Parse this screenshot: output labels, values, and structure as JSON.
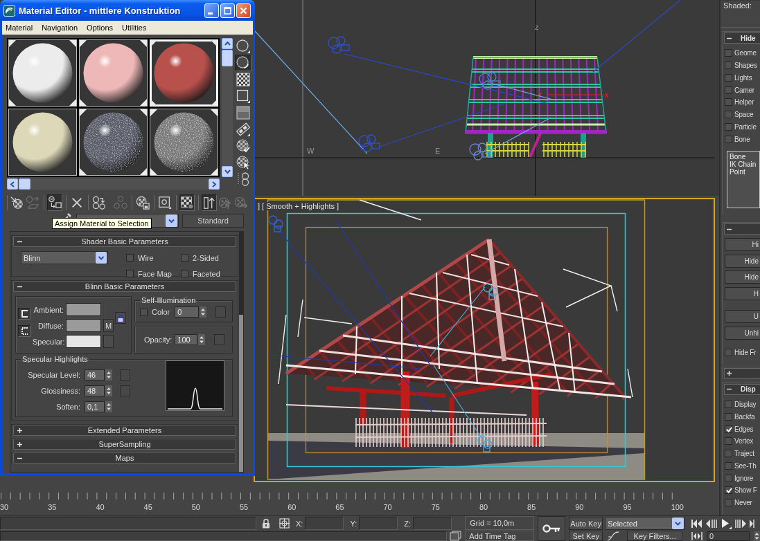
{
  "material_editor": {
    "title": "Material Editor - mittlere Konstruktion",
    "menu": [
      "Material",
      "Navigation",
      "Options",
      "Utilities"
    ],
    "sample_slots": [
      {
        "color": "#ececec",
        "textured": false,
        "in_scene": true,
        "selected": false
      },
      {
        "color": "#efb8b8",
        "textured": false,
        "in_scene": true,
        "selected": false
      },
      {
        "color": "#b8504c",
        "textured": false,
        "in_scene": true,
        "selected": true
      },
      {
        "color": "#dcd8b8",
        "textured": false,
        "in_scene": false,
        "selected": false
      },
      {
        "color": "#5a5c68",
        "textured": true,
        "in_scene": true,
        "selected": false
      },
      {
        "color": "#7a7a7a",
        "textured": true,
        "in_scene": true,
        "selected": false
      }
    ],
    "side_tools": [
      {
        "pressed": false
      },
      {
        "pressed": true
      },
      {
        "pressed": false
      },
      {
        "pressed": false
      },
      {
        "pressed": false
      },
      {
        "pressed": false
      },
      {
        "pressed": false
      },
      {
        "pressed": false
      },
      {
        "pressed": false
      }
    ],
    "toolbar": [
      {
        "pressed": false,
        "disabled": false
      },
      {
        "pressed": false,
        "disabled": true
      },
      {
        "pressed": true,
        "disabled": false
      },
      {
        "pressed": false,
        "disabled": false
      },
      {
        "pressed": false,
        "disabled": false
      },
      {
        "pressed": false,
        "disabled": true
      },
      {
        "pressed": false,
        "disabled": false
      },
      {
        "pressed": false,
        "disabled": false
      },
      {
        "pressed": true,
        "disabled": false
      },
      {
        "pressed": true,
        "disabled": false
      },
      {
        "pressed": false,
        "disabled": true
      },
      {
        "pressed": false,
        "disabled": true
      }
    ],
    "material_type": "Standard",
    "tooltip": "Assign Material to Selection",
    "rollouts": [
      {
        "kind": "shader",
        "title": "Shader Basic Parameters",
        "expanded": true,
        "shader": "Blinn",
        "options": [
          {
            "label": "Wire",
            "checked": false
          },
          {
            "label": "2-Sided",
            "checked": false
          },
          {
            "label": "Face Map",
            "checked": false
          },
          {
            "label": "Faceted",
            "checked": false
          }
        ]
      },
      {
        "kind": "basic",
        "title": "Blinn Basic Parameters",
        "expanded": true,
        "colors": [
          {
            "label": "Ambient:",
            "color": "#9a9a9a",
            "map_slot": false
          },
          {
            "label": "Diffuse:",
            "color": "#9a9a9a",
            "map_slot": true,
            "map_label": "M"
          },
          {
            "label": "Specular:",
            "color": "#e6e6e6",
            "map_slot": true
          }
        ],
        "self_illumination": {
          "title": "Self-Illumination",
          "label": "Color",
          "checked": false,
          "value": "0"
        },
        "opacity": {
          "label": "Opacity:",
          "value": "100"
        },
        "highlights": {
          "title": "Specular Highlights",
          "fields": [
            {
              "label": "Specular Level:",
              "value": "46",
              "map_slot": true
            },
            {
              "label": "Glossiness:",
              "value": "48",
              "map_slot": true
            },
            {
              "label": "Soften:",
              "value": "0,1",
              "map_slot": false
            }
          ]
        }
      },
      {
        "title": "Extended Parameters",
        "expanded": false
      },
      {
        "title": "SuperSampling",
        "expanded": false
      },
      {
        "title": "Maps",
        "expanded": true
      }
    ]
  },
  "front_viewport": {
    "compass_labels": [
      "W",
      "E"
    ],
    "axis_label": "z",
    "gizmo_labels": [
      "y",
      "x"
    ]
  },
  "camera_viewport": {
    "label": "] [ Smooth + Highlights ]",
    "active": true
  },
  "command_panel": {
    "shading_label": "Shaded:",
    "rollouts": [
      {
        "kind": "checklist",
        "title": "Hide",
        "expanded": true,
        "items": [
          {
            "label": "Geome",
            "checked": false
          },
          {
            "label": "Shapes",
            "checked": false
          },
          {
            "label": "Lights",
            "checked": false
          },
          {
            "label": "Camer",
            "checked": false
          },
          {
            "label": "Helper",
            "checked": false
          },
          {
            "label": "Space",
            "checked": false
          },
          {
            "label": "Particle",
            "checked": false
          },
          {
            "label": "Bone",
            "checked": false
          }
        ],
        "list": [
          "Bone",
          "IK Chain",
          "Point"
        ]
      },
      {
        "kind": "buttons",
        "expanded": true,
        "buttons": [
          "Hi",
          "Hide",
          "Hide",
          "H",
          "U",
          "Unhi"
        ],
        "option": {
          "label": "Hide Fr",
          "checked": false
        }
      },
      {
        "kind": "header",
        "expanded": false
      },
      {
        "kind": "checklist",
        "title": "Disp",
        "expanded": true,
        "items": [
          {
            "label": "Display",
            "checked": false
          },
          {
            "label": "Backfa",
            "checked": false
          },
          {
            "label": "Edges",
            "checked": true
          },
          {
            "label": "Vertex",
            "checked": false
          },
          {
            "label": "Traject",
            "checked": false
          },
          {
            "label": "See-Th",
            "checked": false
          },
          {
            "label": "Ignore",
            "checked": false
          },
          {
            "label": "Show F",
            "checked": true
          },
          {
            "label": "Never",
            "checked": false
          }
        ]
      }
    ]
  },
  "timeline": {
    "frame_labels": [
      "30",
      "35",
      "40",
      "45",
      "50",
      "55",
      "60",
      "65",
      "70",
      "75",
      "80",
      "85",
      "90",
      "95",
      "100"
    ]
  },
  "status_bar": {
    "coordinates": [
      "X:",
      "Y:",
      "Z:"
    ],
    "grid": "Grid = 10,0m",
    "time_tag": "Add Time Tag",
    "auto_key": {
      "label": "Auto Key",
      "on": false
    },
    "set_key": "Set Key",
    "key_mode": "Selected",
    "key_filters": "Key Filters...",
    "frame": "0"
  }
}
